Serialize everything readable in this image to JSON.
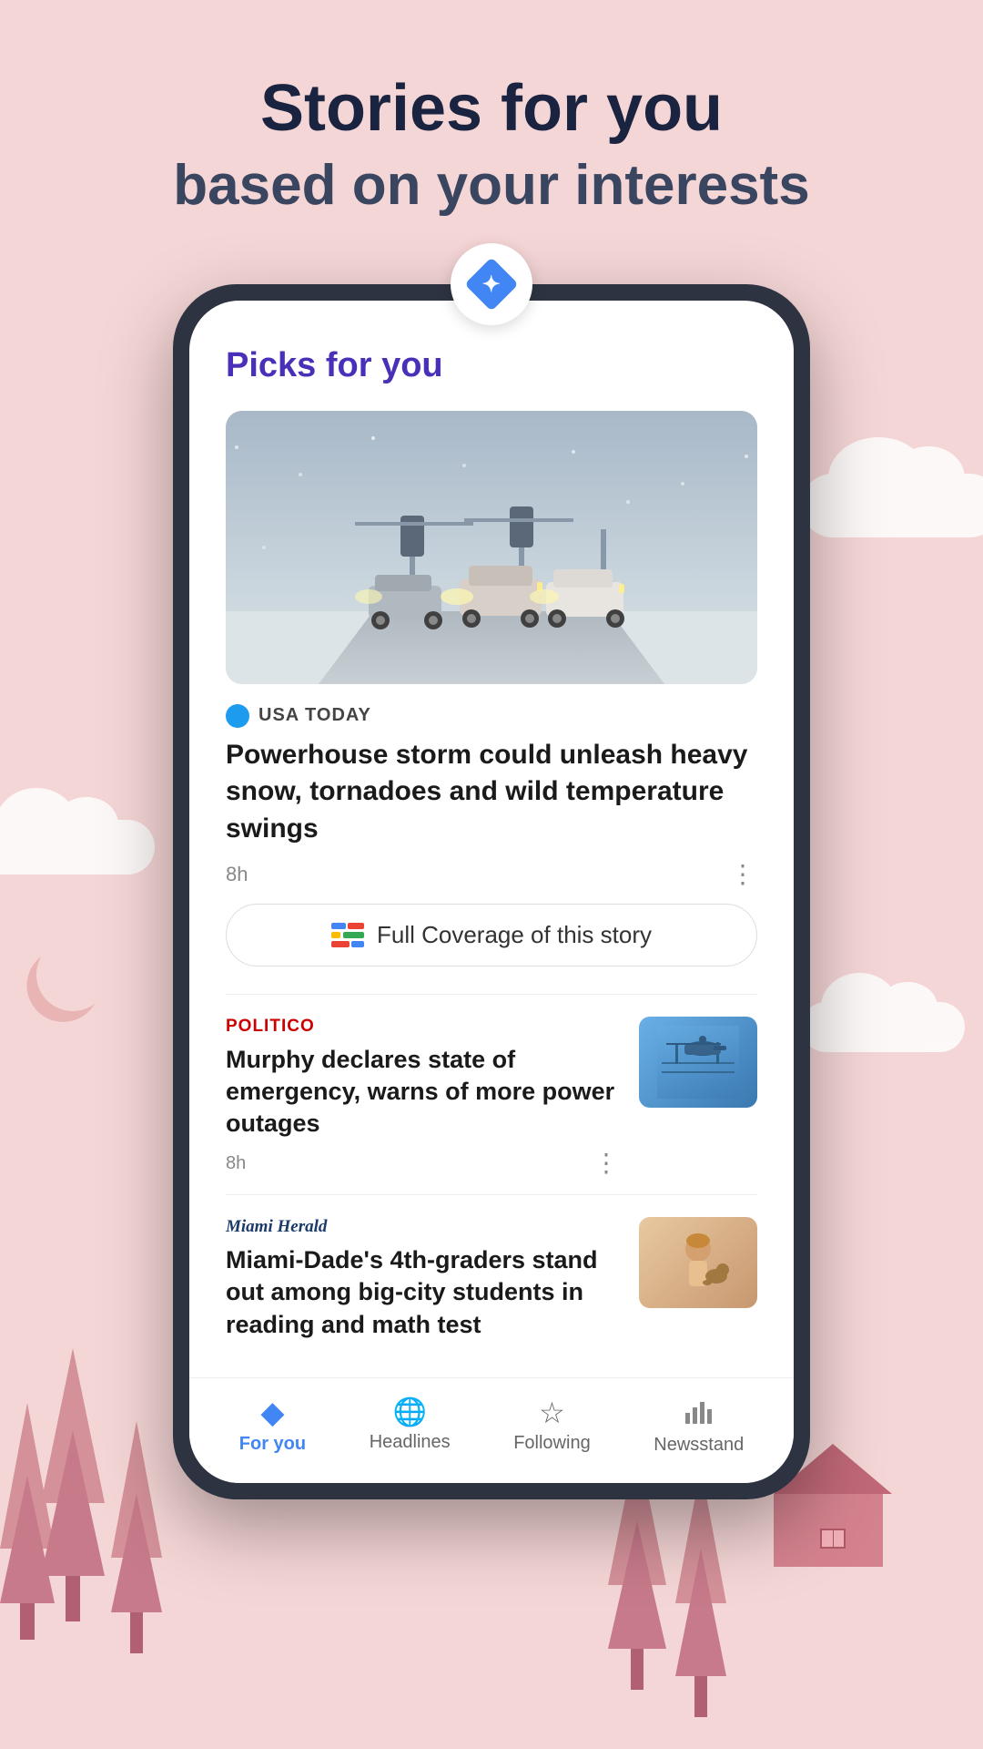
{
  "header": {
    "title_line1": "Stories for you",
    "title_line2": "based on your interests"
  },
  "phone": {
    "picks_label": "Picks for you",
    "article1": {
      "source": "USA TODAY",
      "title": "Powerhouse storm could unleash heavy snow, tornadoes and wild temperature swings",
      "time": "8h",
      "full_coverage": "Full Coverage of this story"
    },
    "article2": {
      "source": "POLITICO",
      "title": "Murphy declares state of emergency, warns of more power outages",
      "time": "8h"
    },
    "article3": {
      "source": "Miami Herald",
      "title": "Miami-Dade's 4th-graders stand out among big-city students in reading and math test"
    }
  },
  "bottomNav": {
    "items": [
      {
        "id": "for-you",
        "label": "For you",
        "icon": "◆",
        "active": true
      },
      {
        "id": "headlines",
        "label": "Headlines",
        "icon": "🌐",
        "active": false
      },
      {
        "id": "following",
        "label": "Following",
        "icon": "☆",
        "active": false
      },
      {
        "id": "newsstand",
        "label": "Newsstand",
        "icon": "📊",
        "active": false
      }
    ]
  },
  "colors": {
    "bg": "#f5d6d6",
    "accent_blue": "#4285F4",
    "accent_purple": "#4a2fb8",
    "politico_red": "#cc0000"
  }
}
